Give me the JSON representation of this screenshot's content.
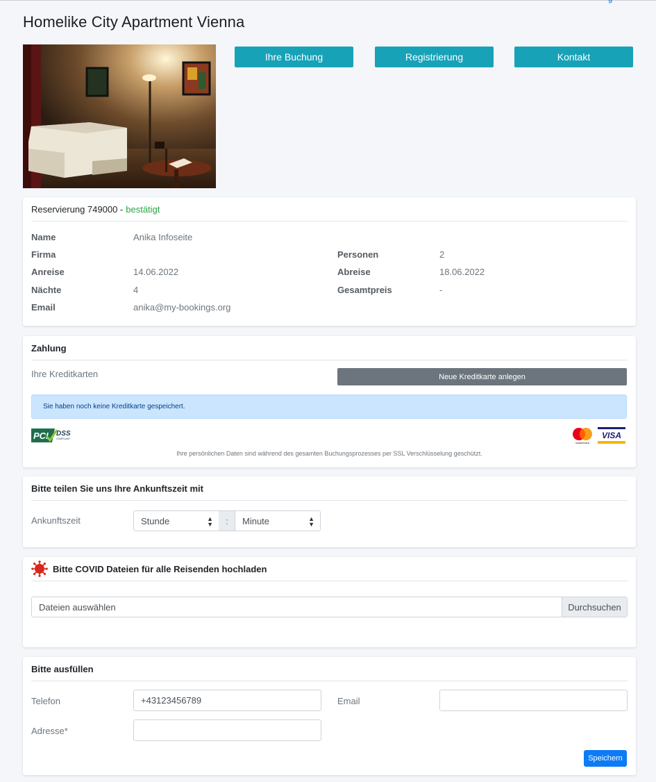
{
  "page": {
    "title": "Homelike City Apartment Vienna",
    "corner_link": "g"
  },
  "nav": {
    "booking": "Ihre Buchung",
    "register": "Registrierung",
    "contact": "Kontakt"
  },
  "reservation": {
    "header_prefix": "Reservierung 749000 - ",
    "status": "bestätigt",
    "status_color": "#28a745",
    "name_label": "Name",
    "name_value": "Anika Infoseite",
    "company_label": "Firma",
    "company_value": "",
    "arrival_label": "Anreise",
    "arrival_value": "14.06.2022",
    "nights_label": "Nächte",
    "nights_value": "4",
    "email_label": "Email",
    "email_value": "anika@my-bookings.org",
    "persons_label": "Personen",
    "persons_value": "2",
    "departure_label": "Abreise",
    "departure_value": "18.06.2022",
    "total_label": "Gesamtpreis",
    "total_value": "-"
  },
  "payment": {
    "header": "Zahlung",
    "cards_label": "Ihre Kreditkarten",
    "new_card_button": "Neue Kreditkarte anlegen",
    "alert": "Sie haben noch keine Kreditkarte gespeichert.",
    "pci_text": "PCI",
    "dss_text": "DSS",
    "compliant_text": "COMPLIANT",
    "mastercard_text": "mastercard",
    "visa_text": "VISA",
    "ssl_note": "Ihre persönlichen Daten sind während des gesamten Buchungsprozesses per SSL Verschlüsselung geschützt."
  },
  "arrival": {
    "header": "Bitte teilen Sie uns Ihre Ankunftszeit mit",
    "label": "Ankunftszeit",
    "hour_select": "Stunde",
    "separator": ":",
    "minute_select": "Minute"
  },
  "covid": {
    "header": "Bitte COVID Dateien für alle Reisenden hochladen",
    "file_placeholder": "Dateien auswählen",
    "browse_button": "Durchsuchen",
    "icon_color": "#d9261c"
  },
  "contact_form": {
    "header": "Bitte ausfüllen",
    "phone_label": "Telefon",
    "phone_value": "+43123456789",
    "email_label": "Email",
    "email_value": "",
    "address_label": "Adresse*",
    "address_value": "",
    "save_button": "Speichern"
  }
}
